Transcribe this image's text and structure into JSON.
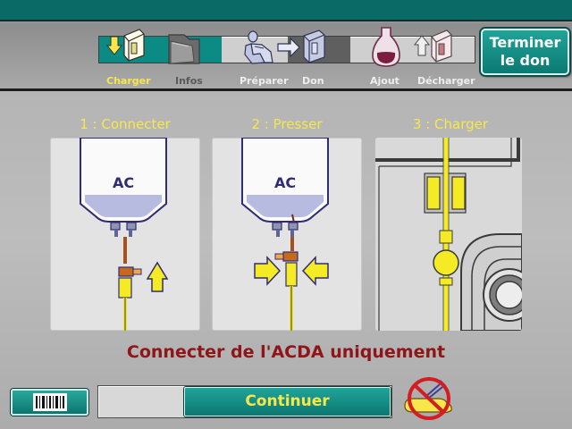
{
  "header": {
    "steps": [
      {
        "id": "charger",
        "label": "Charger",
        "state": "active",
        "icon": "load-tube-icon"
      },
      {
        "id": "infos",
        "label": "Infos",
        "state": "dim",
        "icon": "folder-icon"
      },
      {
        "id": "preparer",
        "label": "Préparer",
        "state": "inactive",
        "icon": "donor-chair-icon"
      },
      {
        "id": "don",
        "label": "Don",
        "state": "inactive",
        "icon": "kit-icon"
      },
      {
        "id": "ajout",
        "label": "Ajout",
        "state": "inactive",
        "icon": "solution-bag-icon"
      },
      {
        "id": "decharger",
        "label": "Décharger",
        "state": "inactive",
        "icon": "unload-kit-icon"
      }
    ],
    "end_button": {
      "line1": "Terminer",
      "line2": "le don"
    }
  },
  "steps": [
    {
      "title": "1 : Connecter",
      "bag_label": "AC",
      "image": "connect-bag-illustration"
    },
    {
      "title": "2  : Presser",
      "bag_label": "AC",
      "image": "press-clamp-illustration"
    },
    {
      "title": "3  : Charger",
      "image": "load-line-illustration"
    }
  ],
  "instruction": "Connecter de l'ACDA uniquement",
  "footer": {
    "continue_label": "Continuer",
    "barcode_icon": "barcode-icon",
    "warning_icon": "no-arm-connection-icon"
  },
  "colors": {
    "teal": "#0b8b83",
    "yellow": "#f7e74b",
    "warning_red": "#8e1518"
  }
}
